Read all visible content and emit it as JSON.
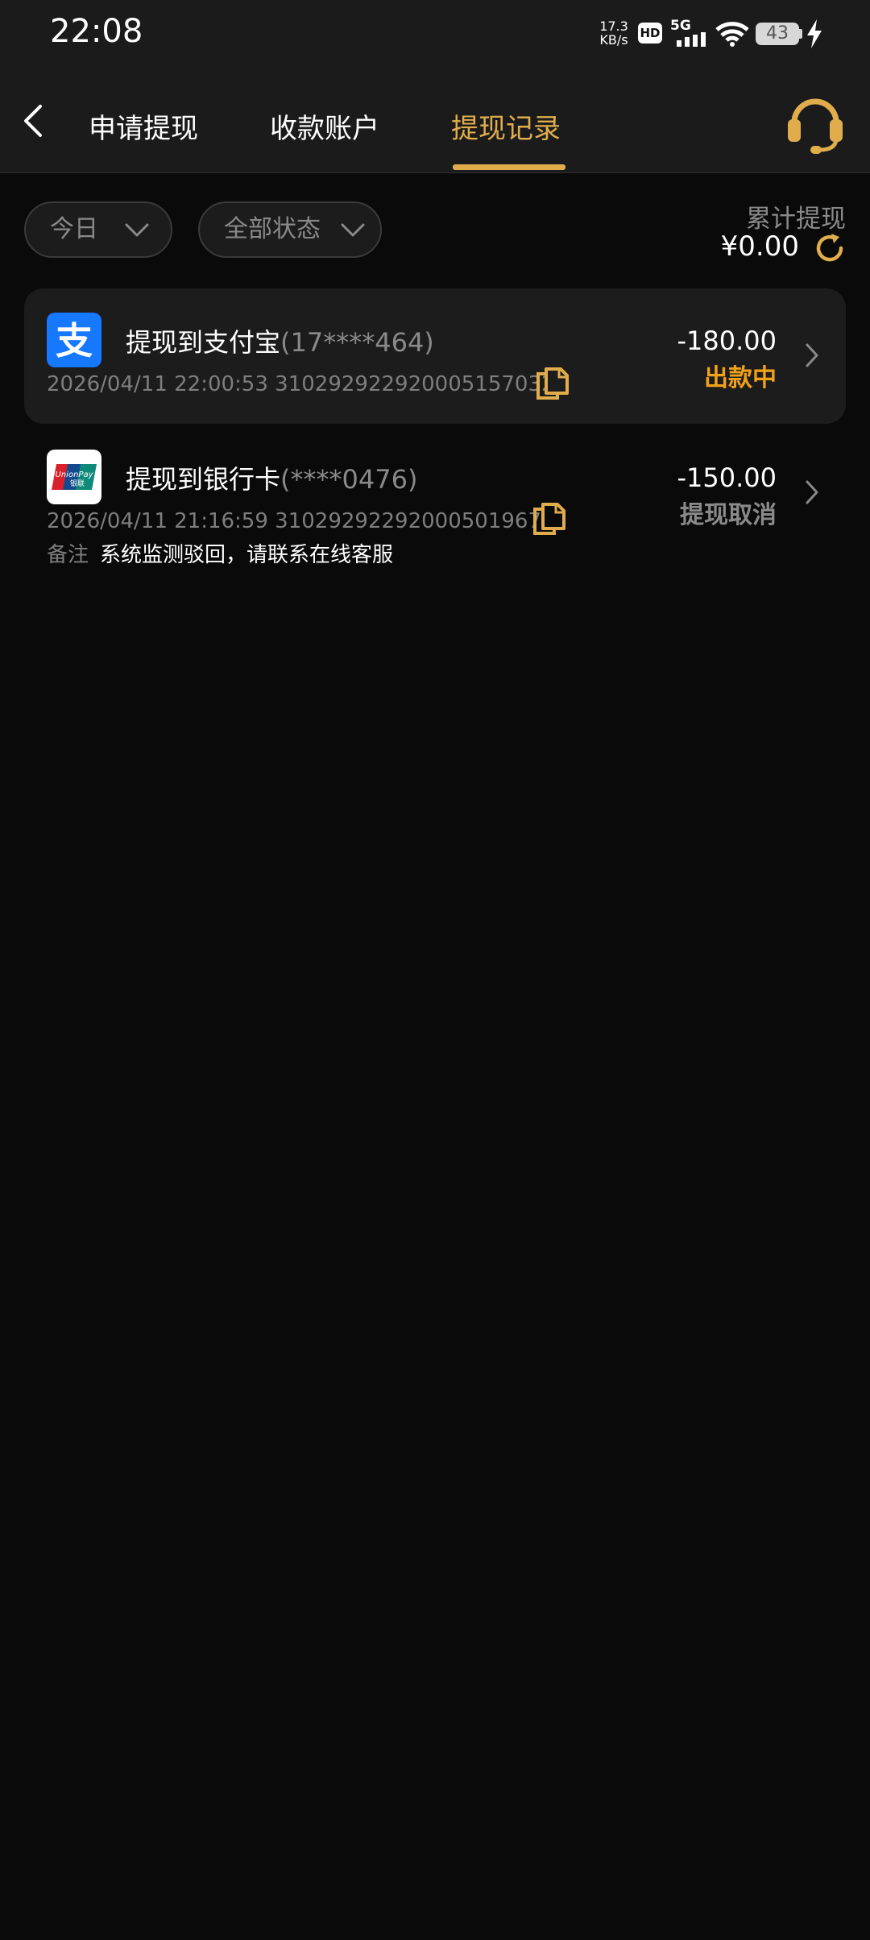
{
  "status_bar": {
    "time": "22:08",
    "net_speed": "17.3",
    "net_speed_unit": "KB/s",
    "hd": "HD",
    "network": "5G",
    "battery": "43",
    "icons": [
      "signal-icon",
      "wifi-icon",
      "battery-icon",
      "charging-bolt-icon"
    ]
  },
  "nav": {
    "back_icon": "chevron-left-icon",
    "tabs": [
      {
        "label": "申请提现",
        "active": false
      },
      {
        "label": "收款账户",
        "active": false
      },
      {
        "label": "提现记录",
        "active": true
      }
    ],
    "support_icon": "headset-icon"
  },
  "filters": {
    "date": "今日",
    "status": "全部状态"
  },
  "summary": {
    "label": "累计提现",
    "amount": "¥0.00"
  },
  "records": [
    {
      "title": "提现到支付宝",
      "account": "(17****464)",
      "datetime": "2026/04/11 22:00:53",
      "order_no": "310292922920005157032",
      "amount": "-180.00",
      "status": "出款中",
      "status_color": "#f0a11a",
      "icon": "alipay-icon"
    },
    {
      "title": "提现到银行卡",
      "account": "(****0476)",
      "datetime": "2026/04/11 21:16:59",
      "order_no": "310292922920005019678",
      "amount": "-150.00",
      "status": "提现取消",
      "status_color": "#8a8a8a",
      "remark_label": "备注",
      "remark": "系统监测驳回，请联系在线客服",
      "icon": "unionpay-icon"
    }
  ],
  "colors": {
    "accent": "#e1ad4c",
    "background": "#0a0a0a",
    "surface": "#1c1c1c"
  }
}
